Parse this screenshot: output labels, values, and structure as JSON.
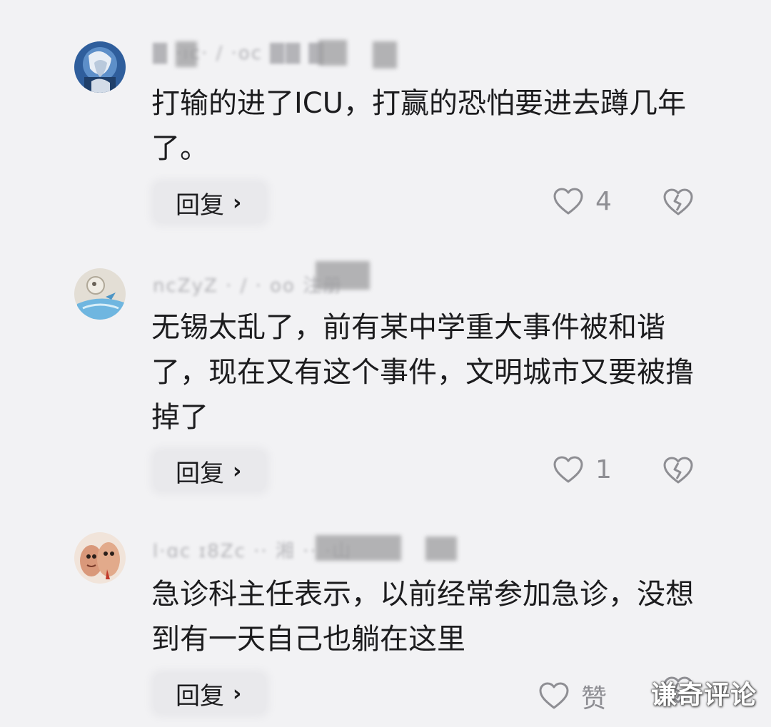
{
  "comments": [
    {
      "username": "█ ·ıc· / ·oc ██ █",
      "text": "打输的进了ICU，打赢的恐怕要进去蹲几年了。",
      "reply_label": "回复",
      "reply_chevron": "›",
      "likes": "4",
      "avatar_color": "#3f6fae"
    },
    {
      "username": "ncZyZ · / · oo 注册",
      "text": "无锡太乱了，前有某中学重大事件被和谐了，现在又有这个事件，文明城市又要被撸掉了",
      "reply_label": "回复",
      "reply_chevron": "›",
      "likes": "1",
      "avatar_color": "#7bb7dd"
    },
    {
      "username": "l·ɑc ɪ8Zc ·· 湘 ·· ·山",
      "text": "急诊科主任表示，以前经常参加急诊，没想到有一天自己也躺在这里",
      "reply_label": "回复",
      "reply_chevron": "›",
      "likes": "赞",
      "avatar_color": "#d99b7c"
    }
  ],
  "icons": {
    "like": "heart-outline-icon",
    "dislike": "broken-heart-icon",
    "reply": "chevron-right-icon"
  },
  "watermark": "谦奇评论"
}
